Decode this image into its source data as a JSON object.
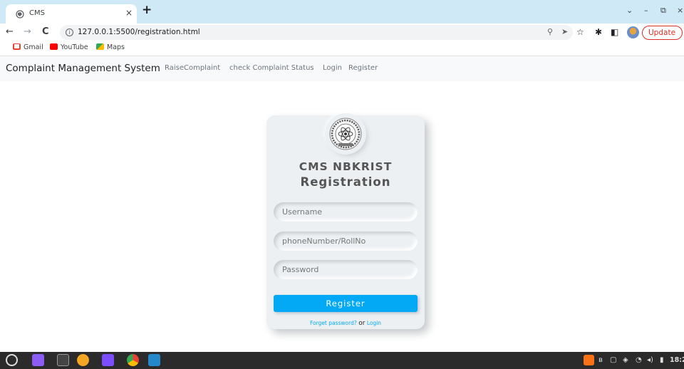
{
  "browser": {
    "tab_title": "CMS",
    "tab_close": "×",
    "new_tab": "+",
    "window_controls": [
      "⌄",
      "–",
      "⧉",
      "×"
    ],
    "nav": {
      "back": "←",
      "forward": "→",
      "reload": "C"
    },
    "url": "127.0.0.1:5500/registration.html",
    "update_label": "Update",
    "update_menu": "⋮",
    "bookmarks": [
      {
        "label": "Gmail",
        "color": "#ea4335"
      },
      {
        "label": "YouTube",
        "color": "#ff0000"
      },
      {
        "label": "Maps",
        "color": "#34a853"
      }
    ]
  },
  "navbar": {
    "brand": "Complaint Management System",
    "links": [
      "RaiseComplaint",
      "check Complaint Status",
      "Login",
      "Register"
    ]
  },
  "form": {
    "title_line1": "CMS NBKRIST",
    "title_line2": "Registration",
    "fields": {
      "username": {
        "placeholder": "Username",
        "value": ""
      },
      "phone": {
        "placeholder": "phoneNumber/RollNo",
        "value": ""
      },
      "password": {
        "placeholder": "Password",
        "value": ""
      }
    },
    "register_label": "Register",
    "forgot_label": "Forget password?",
    "or_label": "or",
    "login_label": "Login"
  },
  "taskbar": {
    "clock": "18:2"
  },
  "colors": {
    "accent": "#03a9f4",
    "tabbar": "#cfe9f7",
    "card_bg": "#ecf0f3",
    "update_red": "#d93025"
  }
}
